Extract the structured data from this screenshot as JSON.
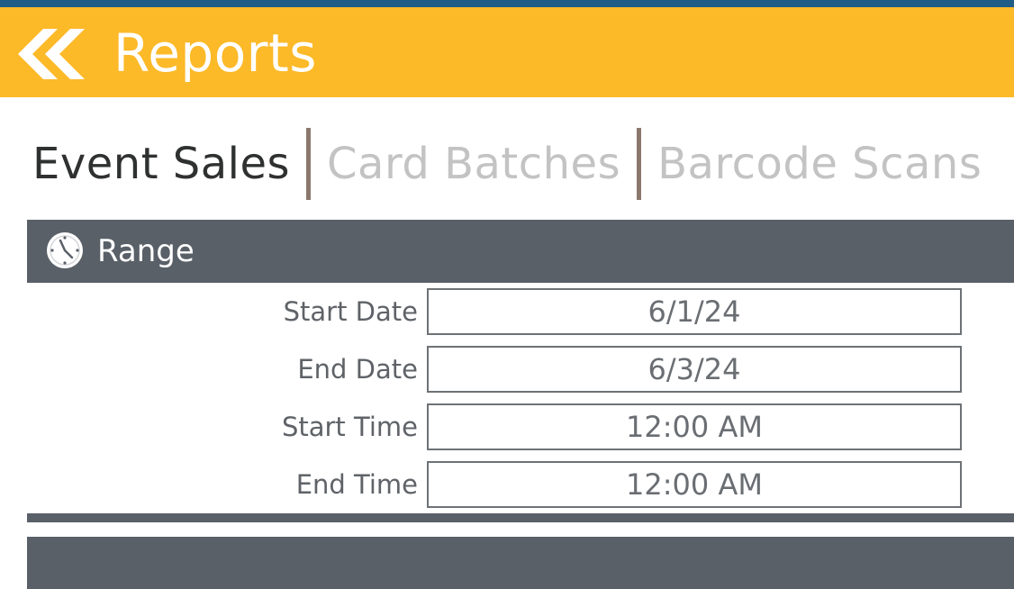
{
  "header": {
    "title": "Reports",
    "back_icon": "double-chevron-left-icon",
    "background_color": "#fcb928",
    "top_strip_color": "#1f5c86"
  },
  "tabs": [
    {
      "label": "Event Sales",
      "active": true
    },
    {
      "label": "Card Batches",
      "active": false
    },
    {
      "label": "Barcode Scans",
      "active": false
    }
  ],
  "range": {
    "title": "Range",
    "icon": "clock-icon",
    "fields": [
      {
        "label": "Start Date",
        "value": "6/1/24"
      },
      {
        "label": "End Date",
        "value": "6/3/24"
      },
      {
        "label": "Start Time",
        "value": "12:00 AM"
      },
      {
        "label": "End Time",
        "value": "12:00 AM"
      }
    ]
  },
  "colors": {
    "section_bar": "#5a6068",
    "tab_divider": "#8b786d",
    "active_tab": "#2f3030",
    "inactive_tab": "#c3c3c3"
  }
}
